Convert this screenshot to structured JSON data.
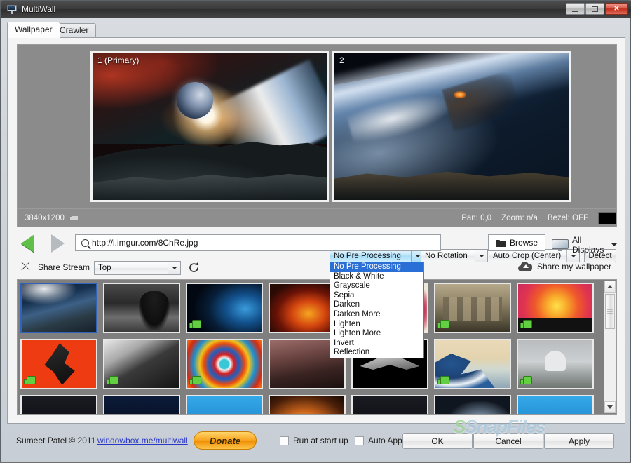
{
  "window": {
    "title": "MultiWall",
    "icon": "monitor-icon",
    "controls": {
      "minimize": "–",
      "restore": "❐",
      "close": "✕"
    }
  },
  "tabs": [
    {
      "label": "Wallpaper",
      "active": true
    },
    {
      "label": "Crawler",
      "active": false
    }
  ],
  "preview": {
    "monitors": [
      {
        "label": "1 (Primary)"
      },
      {
        "label": "2"
      }
    ]
  },
  "infobar": {
    "resolution": "3840x1200",
    "thumbs_icon": "thumbs-up-icon",
    "pan": "Pan: 0,0",
    "zoom": "Zoom: n/a",
    "bezel": "Bezel: OFF",
    "swatch_color": "#000000"
  },
  "processing": {
    "preprocess_selected": "No Pre Processing",
    "preprocess_options": [
      "No Pre Processing",
      "Black & White",
      "Grayscale",
      "Sepia",
      "Darken",
      "Darken More",
      "Lighten",
      "Lighten More",
      "Invert",
      "Reflection"
    ],
    "rotation_selected": "No Rotation",
    "crop_selected": "Auto Crop (Center)",
    "detect_label": "Detect"
  },
  "navigation": {
    "back_icon": "back-arrow-icon",
    "forward_icon": "forward-arrow-icon",
    "search_icon": "search-icon",
    "url_value": "http://i.imgur.com/8ChRe.jpg",
    "browse_label": "Browse",
    "browse_icon": "folder-icon",
    "displays_label": "All Displays",
    "displays_icon": "monitor-icon"
  },
  "share": {
    "shuffle_icon": "shuffle-icon",
    "stream_label": "Share Stream",
    "stream_selected": "Top",
    "refresh_icon": "refresh-icon",
    "share_wallpaper_label": "Share my wallpaper",
    "cloud_icon": "cloud-upload-icon"
  },
  "gallery": {
    "liked_badge_icon": "thumbs-up-badge-icon",
    "rows": [
      [
        {
          "art": "a-earth",
          "liked": false,
          "selected": true
        },
        {
          "art": "a-rorschach",
          "liked": false,
          "selected": false
        },
        {
          "art": "a-blueplanet",
          "liked": true,
          "selected": false
        },
        {
          "art": "a-fire",
          "liked": false,
          "selected": false
        },
        {
          "art": "a-lily",
          "liked": true,
          "selected": false
        },
        {
          "art": "a-ruins",
          "liked": true,
          "selected": false
        },
        {
          "art": "a-safari",
          "liked": true,
          "selected": false
        }
      ],
      [
        {
          "art": "a-red",
          "liked": true,
          "selected": false
        },
        {
          "art": "a-typewriter",
          "liked": true,
          "selected": false
        },
        {
          "art": "a-swirl",
          "liked": true,
          "selected": false
        },
        {
          "art": "a-steampunk",
          "liked": false,
          "selected": false
        },
        {
          "art": "a-bomber",
          "liked": false,
          "selected": false
        },
        {
          "art": "a-wave",
          "liked": true,
          "selected": false
        },
        {
          "art": "a-taj",
          "liked": true,
          "selected": false
        }
      ],
      [
        {
          "art": "a-dark",
          "liked": false,
          "selected": false
        },
        {
          "art": "a-darkblue",
          "liked": false,
          "selected": false
        },
        {
          "art": "a-brightblue",
          "liked": false,
          "selected": false
        },
        {
          "art": "a-campfire",
          "liked": false,
          "selected": false
        },
        {
          "art": "a-dark",
          "liked": false,
          "selected": false
        },
        {
          "art": "a-greyearth",
          "liked": false,
          "selected": false
        },
        {
          "art": "a-brightblue",
          "liked": false,
          "selected": false
        }
      ]
    ]
  },
  "watermark": {
    "prefix": "S",
    "text": "SnapFiles"
  },
  "footer": {
    "copyright": "Sumeet Patel © 2011",
    "link": "windowbox.me/multiwall",
    "donate_label": "Donate",
    "run_at_startup_label": "Run at start up",
    "auto_apply_label": "Auto Apply",
    "ok_label": "OK",
    "cancel_label": "Cancel",
    "apply_label": "Apply"
  }
}
